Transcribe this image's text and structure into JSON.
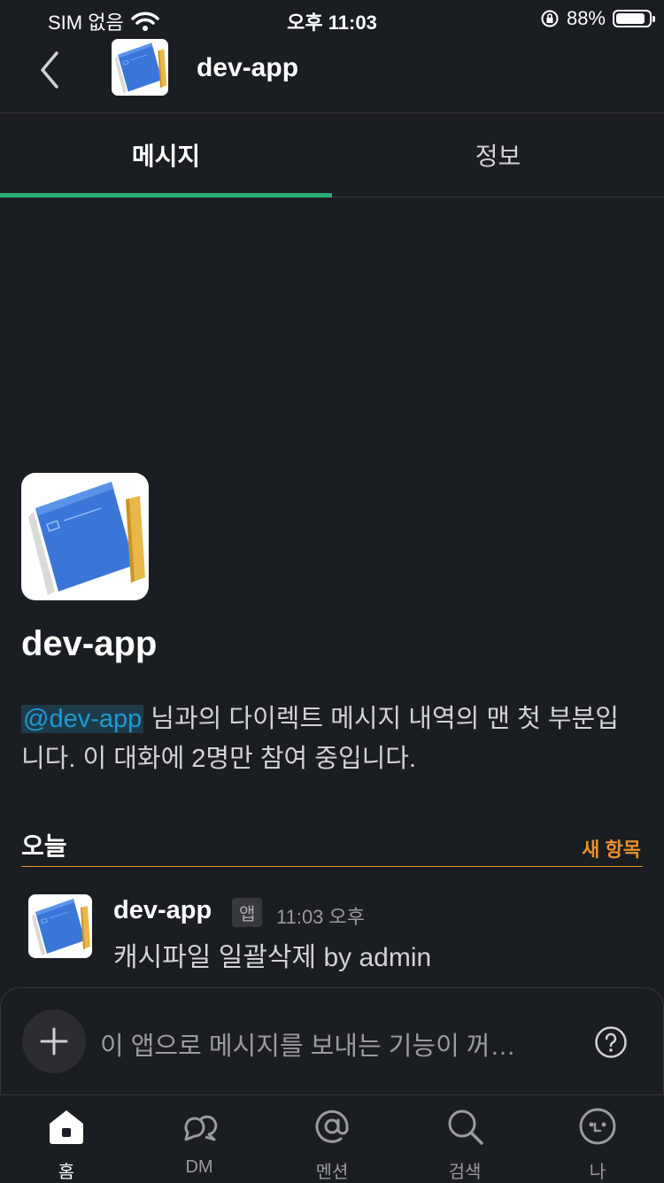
{
  "status_bar": {
    "carrier": "SIM 없음",
    "time": "오후 11:03",
    "battery": "88%",
    "battery_level": 0.88
  },
  "header": {
    "title": "dev-app"
  },
  "tabs": [
    {
      "label": "메시지"
    },
    {
      "label": "정보"
    }
  ],
  "intro": {
    "title": "dev-app",
    "mention": "@dev-app",
    "text": " 님과의 다이렉트 메시지 내역의 맨 첫 부분입니다. 이 대화에 2명만 참여 중입니다."
  },
  "divider": {
    "day": "오늘",
    "new": "새 항목"
  },
  "message": {
    "sender": "dev-app",
    "badge": "앱",
    "time": "11:03 오후",
    "text": "캐시파일 일괄삭제 by admin"
  },
  "composer": {
    "placeholder": "이 앱으로 메시지를 보내는 기능이 꺼…"
  },
  "tabbar": [
    {
      "label": "홈",
      "icon": "home-icon"
    },
    {
      "label": "DM",
      "icon": "dm-icon"
    },
    {
      "label": "멘션",
      "icon": "mention-icon"
    },
    {
      "label": "검색",
      "icon": "search-icon"
    },
    {
      "label": "나",
      "icon": "profile-icon"
    }
  ],
  "colors": {
    "background": "#1a1d21",
    "tab_indicator": "#2bac76",
    "new_divider": "#e8912d",
    "mention": "#1d9bd1"
  }
}
